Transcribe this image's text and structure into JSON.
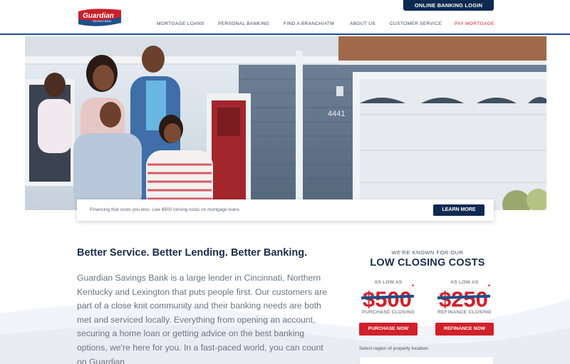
{
  "header": {
    "logo_text": "Guardian",
    "logo_subtext": "SAVINGS BANK",
    "login_label": "ONLINE BANKING LOGIN",
    "nav": [
      "MORTGAGE LOANS",
      "PERSONAL BANKING",
      "FIND A BRANCH/ATM",
      "ABOUT US",
      "CUSTOMER SERVICE",
      "PAY MORTGAGE"
    ]
  },
  "hero": {
    "house_number": "4441"
  },
  "banner": {
    "text": "Financing that costs you less. Low $500 closing costs on mortgage loans.",
    "button_label": "LEARN MORE"
  },
  "main": {
    "title": "Better Service. Better Lending. Better Banking.",
    "body": "Guardian Savings Bank is a large lender in Cincinnati, Northern Kentucky and Lexington that puts people first. Our customers are part of a close knit community and their banking needs are both met and serviced locally. Everything from opening an account, securing a home loan or getting advice on the best banking options, we're here for you. In a fast-paced world, you can count on Guardian"
  },
  "closing": {
    "kicker": "WE'RE KNOWN FOR OUR",
    "title": "LOW CLOSING COSTS",
    "offers": [
      {
        "as_low": "AS LOW AS",
        "price": "$500",
        "label": "PURCHASE CLOSING",
        "button": "PURCHASE NOW"
      },
      {
        "as_low": "AS LOW AS",
        "price": "$250",
        "label": "REFINANCE CLOSING",
        "button": "REFINANCE NOW"
      }
    ],
    "asterisk": "*",
    "region_label": "Select region of property location:"
  },
  "colors": {
    "navy": "#0e2a52",
    "red": "#d0202a",
    "blue_strike": "#1c4f8c"
  }
}
